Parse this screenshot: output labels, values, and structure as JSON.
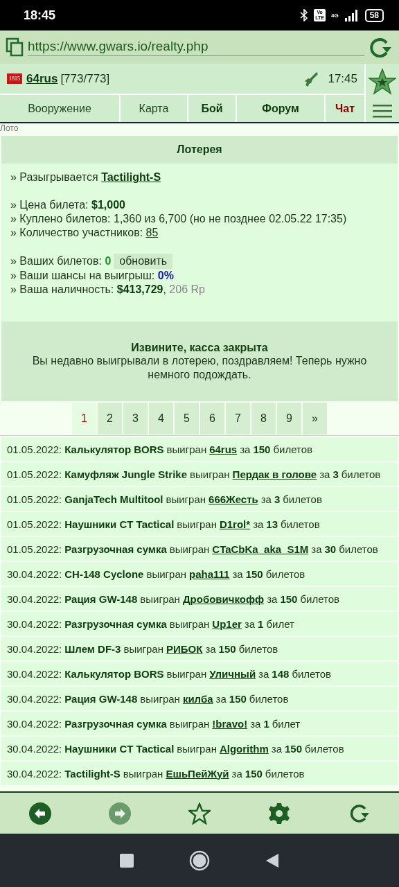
{
  "status_bar": {
    "time": "18:45",
    "volte": [
      "Vo",
      "LTE"
    ],
    "network": "4G",
    "battery": "58"
  },
  "browser": {
    "url": "https://www.gwars.io/realty.php"
  },
  "header": {
    "clan_badge": "1815",
    "user": "64rus",
    "hp": "[773/773]",
    "server_time": "17:45"
  },
  "nav_tabs": [
    {
      "label": "Вооружение",
      "kind": "plain"
    },
    {
      "label": "Карта",
      "kind": "plain"
    },
    {
      "label": "Бой",
      "kind": "bold"
    },
    {
      "label": "Форум",
      "kind": "bold"
    },
    {
      "label": "Чат",
      "kind": "alert"
    }
  ],
  "breadcrumb": "Лото",
  "lottery": {
    "title": "Лотерея",
    "groups": [
      [
        {
          "label": "» Разыгрывается",
          "value": "Tactilight-S",
          "kind": "item-link"
        }
      ],
      [
        {
          "label": "» Цена билета:",
          "value": "$1,000",
          "kind": "bold"
        },
        {
          "label": "» Куплено билетов: 1,360 из 6,700 (но не позднее 02.05.22 17:35)",
          "kind": "plain"
        },
        {
          "label": "» Количество участников:",
          "value": "85",
          "kind": "count-link"
        }
      ],
      [
        {
          "label": "» Ваших билетов:",
          "value": "0",
          "kind": "green",
          "button": "обновить"
        },
        {
          "label": "» Ваши шансы на выигрыш:",
          "value": "0%",
          "kind": "blue"
        },
        {
          "label": "» Ваша наличность:",
          "value": "$413,729",
          "kind": "cash",
          "separator": ",",
          "extra": "206 Rp"
        }
      ]
    ],
    "notice_title": "Извините, касса закрыта",
    "notice_text": "Вы недавно выигрывали в лотерею, поздравляем! Теперь нужно немного подождать."
  },
  "pages": [
    {
      "label": "1",
      "selected": true
    },
    {
      "label": "2",
      "selected": false
    },
    {
      "label": "3",
      "selected": false
    },
    {
      "label": "4",
      "selected": false
    },
    {
      "label": "5",
      "selected": false
    },
    {
      "label": "6",
      "selected": false
    },
    {
      "label": "7",
      "selected": false
    },
    {
      "label": "8",
      "selected": false
    },
    {
      "label": "9",
      "selected": false
    },
    {
      "label": "»",
      "selected": false
    }
  ],
  "winners": [
    {
      "date": "01.05.2022:",
      "item": "Калькулятор BORS",
      "verb": "выигран",
      "winner": "64rus",
      "for": "за",
      "count": "150",
      "unit": "билетов"
    },
    {
      "date": "01.05.2022:",
      "item": "Камуфляж Jungle Strike",
      "verb": "выигран",
      "winner": "Пердак в голове",
      "for": "за",
      "count": "3",
      "unit": "билетов"
    },
    {
      "date": "01.05.2022:",
      "item": "GanjaTech Multitool",
      "verb": "выигран",
      "winner": "666Жесть",
      "for": "за",
      "count": "3",
      "unit": "билетов"
    },
    {
      "date": "01.05.2022:",
      "item": "Наушники CT Tactical",
      "verb": "выигран",
      "winner": "D1rol*",
      "for": "за",
      "count": "13",
      "unit": "билетов"
    },
    {
      "date": "01.05.2022:",
      "item": "Разгрузочная сумка",
      "verb": "выигран",
      "winner": "CTaCbKa_aka_S1M",
      "for": "за",
      "count": "30",
      "unit": "билетов"
    },
    {
      "date": "30.04.2022:",
      "item": "CH-148 Cyclone",
      "verb": "выигран",
      "winner": "paha111",
      "for": "за",
      "count": "150",
      "unit": "билетов"
    },
    {
      "date": "30.04.2022:",
      "item": "Рация GW-148",
      "verb": "выигран",
      "winner": "Дробовичкофф",
      "for": "за",
      "count": "150",
      "unit": "билетов"
    },
    {
      "date": "30.04.2022:",
      "item": "Разгрузочная сумка",
      "verb": "выигран",
      "winner": "Up1er",
      "for": "за",
      "count": "1",
      "unit": "билет"
    },
    {
      "date": "30.04.2022:",
      "item": "Шлем DF-3",
      "verb": "выигран",
      "winner": "РИБОК",
      "for": "за",
      "count": "150",
      "unit": "билетов"
    },
    {
      "date": "30.04.2022:",
      "item": "Калькулятор BORS",
      "verb": "выигран",
      "winner": "Уличный",
      "for": "за",
      "count": "148",
      "unit": "билетов"
    },
    {
      "date": "30.04.2022:",
      "item": "Рация GW-148",
      "verb": "выигран",
      "winner": "килба",
      "for": "за",
      "count": "150",
      "unit": "билетов"
    },
    {
      "date": "30.04.2022:",
      "item": "Разгрузочная сумка",
      "verb": "выигран",
      "winner": "!bravo!",
      "for": "за",
      "count": "1",
      "unit": "билет"
    },
    {
      "date": "30.04.2022:",
      "item": "Наушники CT Tactical",
      "verb": "выигран",
      "winner": "Algorithm",
      "for": "за",
      "count": "150",
      "unit": "билетов"
    },
    {
      "date": "30.04.2022:",
      "item": "Tactilight-S",
      "verb": "выигран",
      "winner": "ЕшьПейЖуй",
      "for": "за",
      "count": "150",
      "unit": "билетов"
    }
  ],
  "toolbar": [
    {
      "kind": "back",
      "disabled": false
    },
    {
      "kind": "forward",
      "disabled": true
    },
    {
      "kind": "star",
      "disabled": false
    },
    {
      "kind": "settings",
      "disabled": false
    },
    {
      "kind": "reload",
      "disabled": false
    }
  ]
}
